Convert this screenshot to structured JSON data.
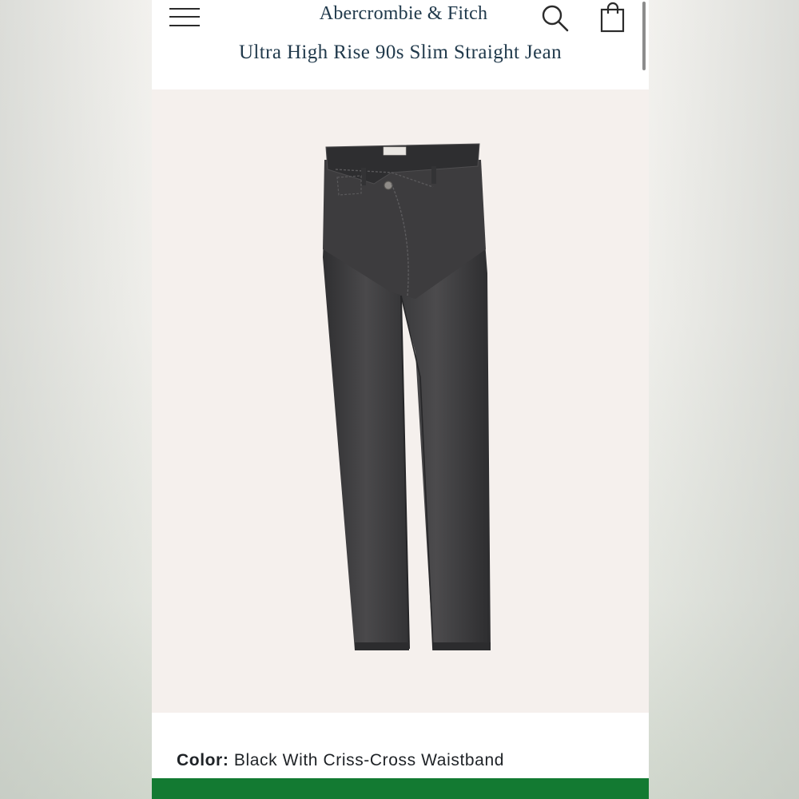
{
  "header": {
    "brand": "Abercrombie & Fitch",
    "menu_icon": "hamburger-menu-icon",
    "search_icon": "search-icon",
    "bag_icon": "shopping-bag-icon"
  },
  "product": {
    "title": "Ultra High Rise 90s Slim Straight Jean",
    "image_alt": "Black washed jeans with criss-cross waistband",
    "color_label": "Color:",
    "color_value": "Black With Criss-Cross Waistband"
  },
  "colors": {
    "brand_navy": "#213a4c",
    "image_bg": "#f5f0ed",
    "denim": "#3a3a3c",
    "cta_green": "#137a32"
  }
}
